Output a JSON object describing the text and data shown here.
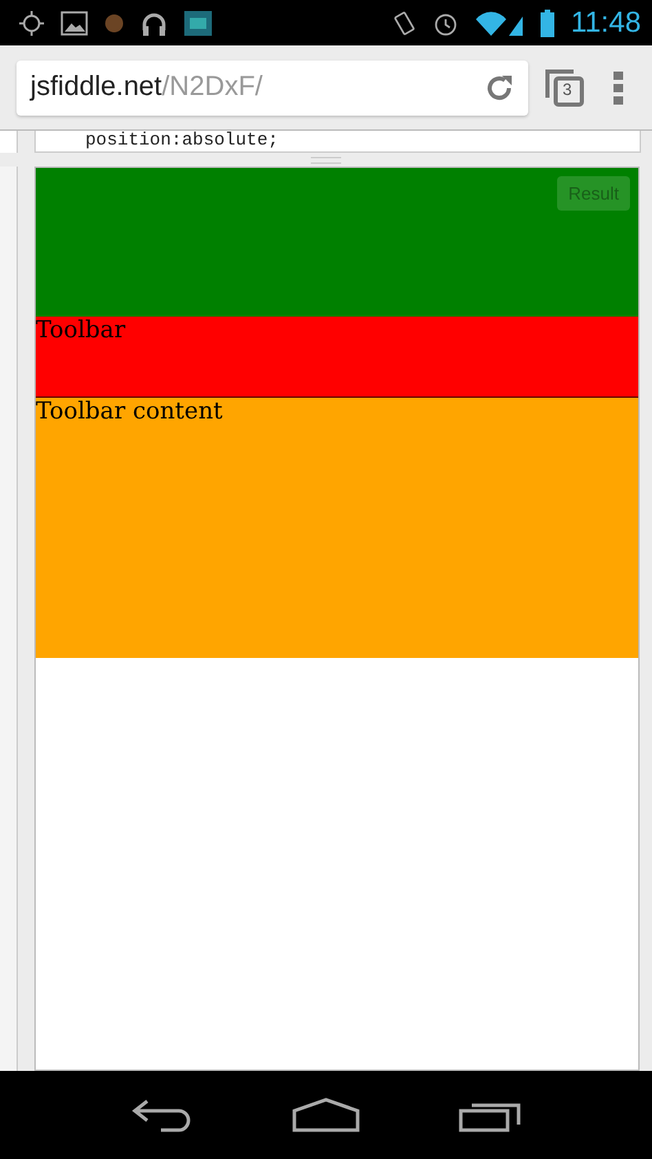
{
  "status_bar": {
    "time": "11:48"
  },
  "address_bar": {
    "host": "jsfiddle.net",
    "path": "/N2DxF/",
    "tab_count": "3"
  },
  "code_line": "position:absolute;",
  "result": {
    "button": "Result",
    "sections": [
      {
        "kind": "header",
        "color": "#008000"
      },
      {
        "kind": "toolbar",
        "color": "#ff0000",
        "text": "Toolbar"
      },
      {
        "kind": "content",
        "color": "#ffa500",
        "text": "Toolbar content"
      }
    ]
  }
}
